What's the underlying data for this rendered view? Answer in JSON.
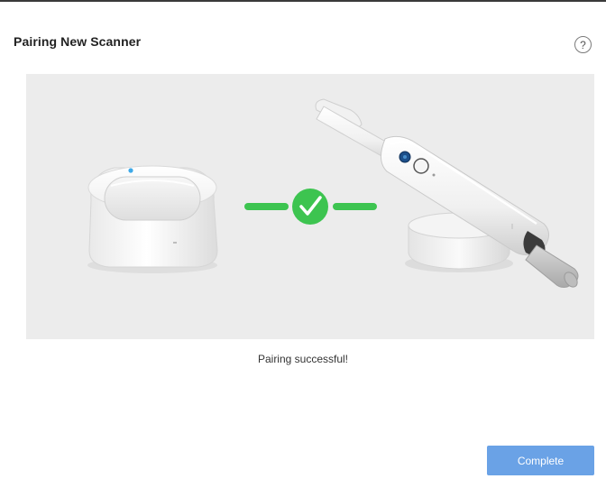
{
  "dialog": {
    "title": "Pairing New Scanner",
    "help_glyph": "?",
    "help_icon": "question-circle-icon",
    "status_message": "Pairing successful!",
    "complete_label": "Complete"
  },
  "illustration": {
    "devices": [
      "wireless-hub",
      "intraoral-scanner"
    ],
    "connection_state": "paired",
    "connection_icon": "check-circle-icon",
    "colors": {
      "connector": "#3dc450",
      "background": "#ececec",
      "hub_light": "#3ea9e8",
      "scanner_button": "#1d4f8a"
    }
  },
  "colors": {
    "primary_button": "#6aa2e6",
    "title_text": "#222222",
    "body_text": "#333333"
  }
}
